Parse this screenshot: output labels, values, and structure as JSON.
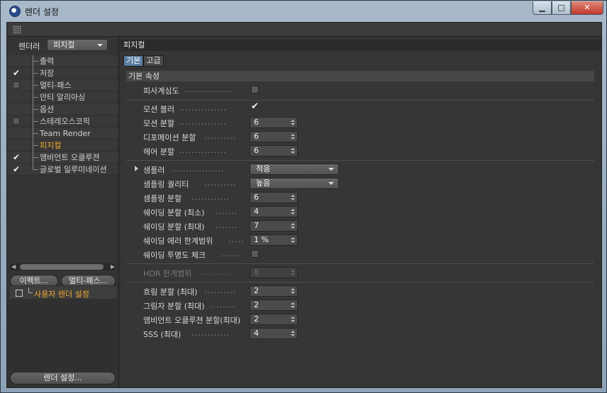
{
  "window": {
    "title": "렌더 설정"
  },
  "window_controls": {
    "minimize": "▁",
    "maximize": "□",
    "close": "✕"
  },
  "left_panel": {
    "renderer_label": "렌더러",
    "renderer_value": "피지컬",
    "items": [
      {
        "label": "출력",
        "check": "none",
        "active": false
      },
      {
        "label": "저장",
        "check": "tick",
        "active": false
      },
      {
        "label": "멀티-패스",
        "check": "box",
        "active": false
      },
      {
        "label": "안티 알리아싱",
        "check": "none",
        "active": false
      },
      {
        "label": "옵션",
        "check": "none",
        "active": false
      },
      {
        "label": "스테레오스코픽",
        "check": "box",
        "active": false
      },
      {
        "label": "Team Render",
        "check": "none",
        "active": false
      },
      {
        "label": "피지컬",
        "check": "none",
        "active": true
      },
      {
        "label": "앰비언트 오클루젼",
        "check": "tick",
        "active": false
      },
      {
        "label": "글로벌 일루미네이션",
        "check": "tick",
        "active": false
      }
    ],
    "effect_button": "이펙트...",
    "multipass_button": "멀티-패스...",
    "user_setting": "사용자 렌더 설정",
    "render_settings_button": "렌더 설정..."
  },
  "right_panel": {
    "section_title": "피지컬",
    "tabs": [
      {
        "label": "기본",
        "active": true
      },
      {
        "label": "고급",
        "active": false
      }
    ],
    "group_title": "기본 속성",
    "depth_of_field": {
      "label": "피사계심도",
      "checked": false
    },
    "motion_blur": {
      "label": "모션 블러",
      "checked": true
    },
    "motion_subdiv": {
      "label": "모션 분할",
      "value": "6"
    },
    "deform_subdiv": {
      "label": "디포메이션 분할",
      "value": "6"
    },
    "hair_subdiv": {
      "label": "헤어 분할",
      "value": "6"
    },
    "sampler": {
      "label": "샘플러",
      "value": "적응"
    },
    "sampling_quality": {
      "label": "샘플링 퀄리티",
      "value": "높음"
    },
    "sampling_subdiv": {
      "label": "샘플링 분할",
      "value": "6"
    },
    "shading_subdiv_min": {
      "label": "쉐이딩 분할 (최소)",
      "value": "4"
    },
    "shading_subdiv_max": {
      "label": "쉐이딩 분할 (최대)",
      "value": "7"
    },
    "shading_error": {
      "label": "쉐이딩 에러 한계범위",
      "value": "1 %"
    },
    "shading_transparency": {
      "label": "쉐이딩 투명도 체크",
      "checked": false
    },
    "hdr_threshold": {
      "label": "HDR 한계범위",
      "value": "8"
    },
    "blurriness_subdiv": {
      "label": "흐림 분할 (최대)",
      "value": "2"
    },
    "shadow_subdiv": {
      "label": "그림자 분할 (최대)",
      "value": "2"
    },
    "ao_subdiv": {
      "label": "앰비언트 오클루젼 분할(최대)",
      "value": "2"
    },
    "sss": {
      "label": "SSS (최대)",
      "value": "4"
    }
  },
  "colors": {
    "accent_active": "#f0a830",
    "tab_active": "#5b7ea3"
  }
}
